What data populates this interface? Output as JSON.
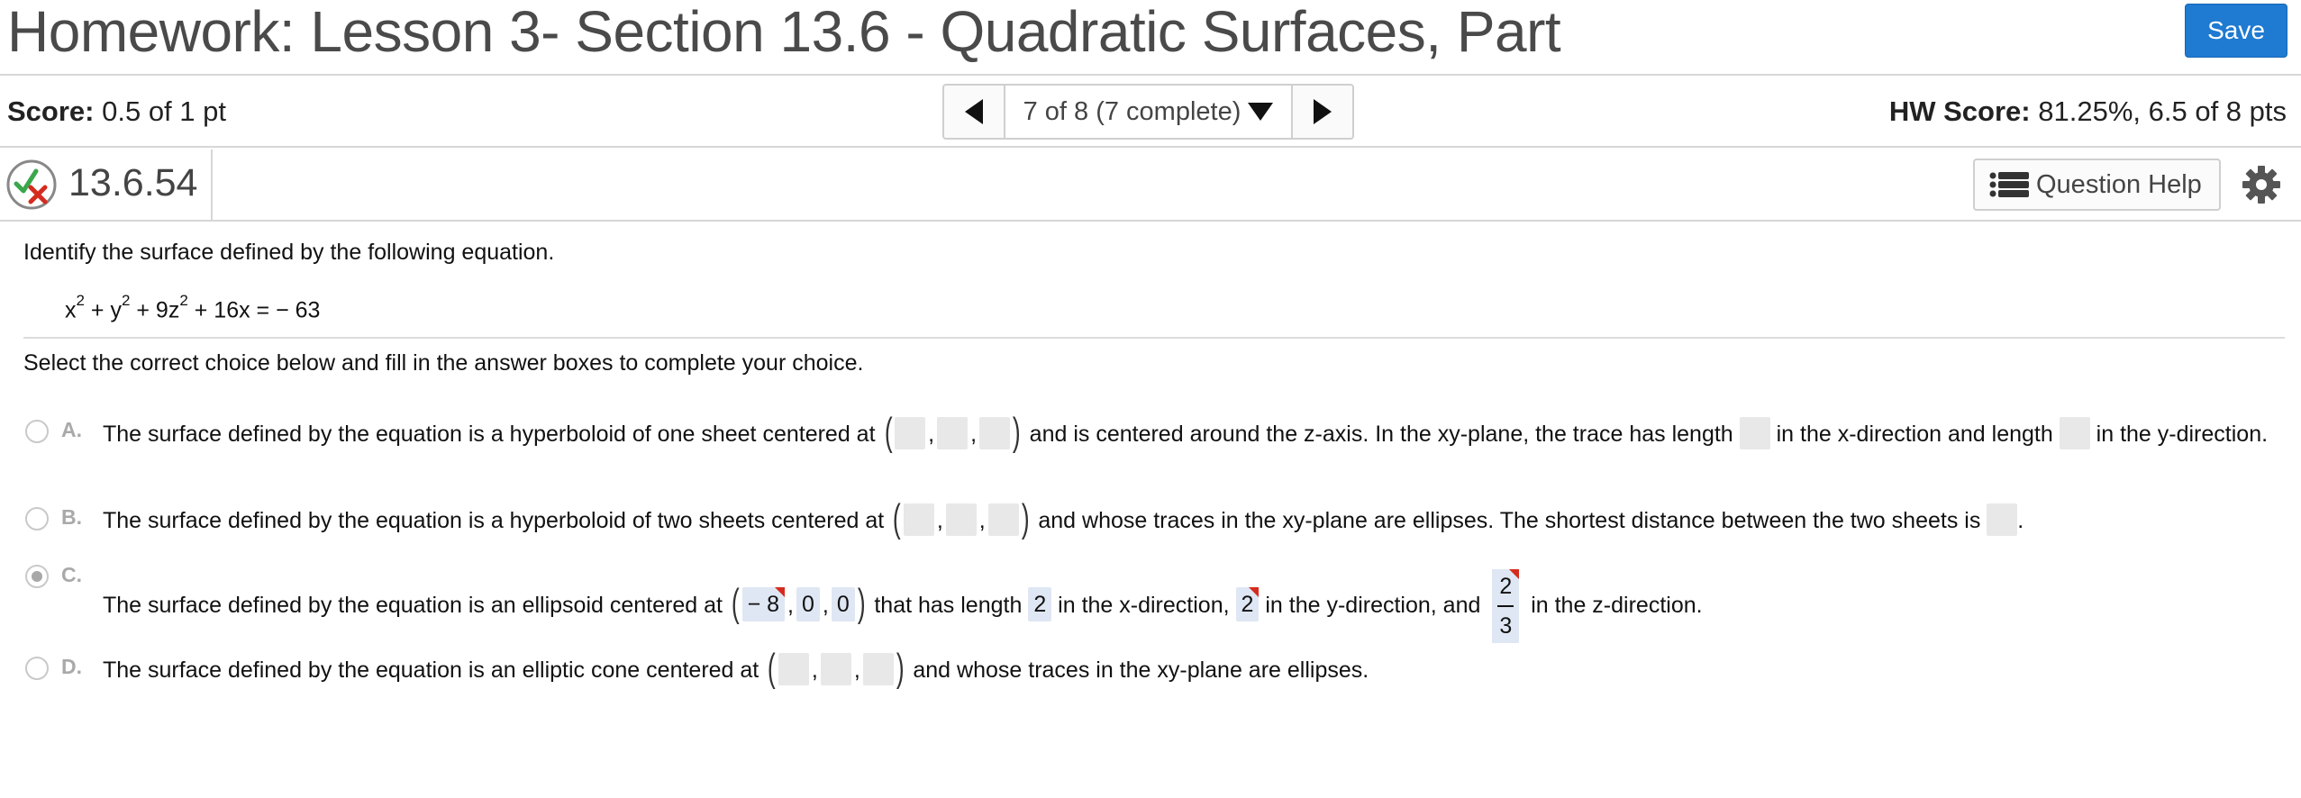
{
  "header": {
    "title": "Homework: Lesson 3- Section 13.6 - Quadratic Surfaces, Part",
    "save_label": "Save"
  },
  "scorebar": {
    "score_label": "Score:",
    "score_value": "0.5 of 1 pt",
    "nav_position": "7 of 8 (7 complete)",
    "hw_score_label": "HW Score:",
    "hw_score_value": "81.25%, 6.5 of 8 pts"
  },
  "question": {
    "id": "13.6.54",
    "help_label": "Question Help",
    "prompt": "Identify the surface defined by the following equation.",
    "equation": {
      "t1": "x",
      "e1": "2",
      "t2": " + y",
      "e2": "2",
      "t3": " + 9z",
      "e3": "2",
      "t4": " + 16x = − 63"
    },
    "instruction": "Select the correct choice below and fill in the answer boxes to complete your choice."
  },
  "choices": [
    {
      "letter": "A.",
      "selected": false,
      "text1": "The surface defined by the equation is a hyperboloid of one sheet centered at",
      "text2": "and is centered around the z-axis. In the xy-plane, the trace has length",
      "text3": "in the x-direction and length",
      "text4": "in the y-direction."
    },
    {
      "letter": "B.",
      "selected": false,
      "text1": "The surface defined by the equation is a hyperboloid of two sheets centered at",
      "text2": "and whose traces in the xy-plane are ellipses. The shortest distance between the two sheets is",
      "text3": "."
    },
    {
      "letter": "C.",
      "selected": true,
      "text1": "The surface defined by the equation is an ellipsoid centered at",
      "center": [
        "− 8",
        "0",
        "0"
      ],
      "text2": "that has length",
      "x_length": "2",
      "text3": "in the x-direction,",
      "y_length": "2",
      "text4": "in the y-direction, and",
      "z_length_num": "2",
      "z_length_den": "3",
      "text5": "in the z-direction."
    },
    {
      "letter": "D.",
      "selected": false,
      "text1": "The surface defined by the equation is an elliptic cone centered at",
      "text2": "and whose traces in the xy-plane are ellipses."
    }
  ],
  "colors": {
    "save_button": "#1f7ad1",
    "filled_box": "#dfe7f4",
    "empty_box": "#e8e8e8",
    "incorrect_flag": "#d52b1e",
    "partial_check": "#3aa74a"
  },
  "icons": [
    "previous-arrow-icon",
    "dropdown-arrow-icon",
    "next-arrow-icon",
    "partial-credit-icon",
    "list-icon",
    "gear-icon"
  ]
}
